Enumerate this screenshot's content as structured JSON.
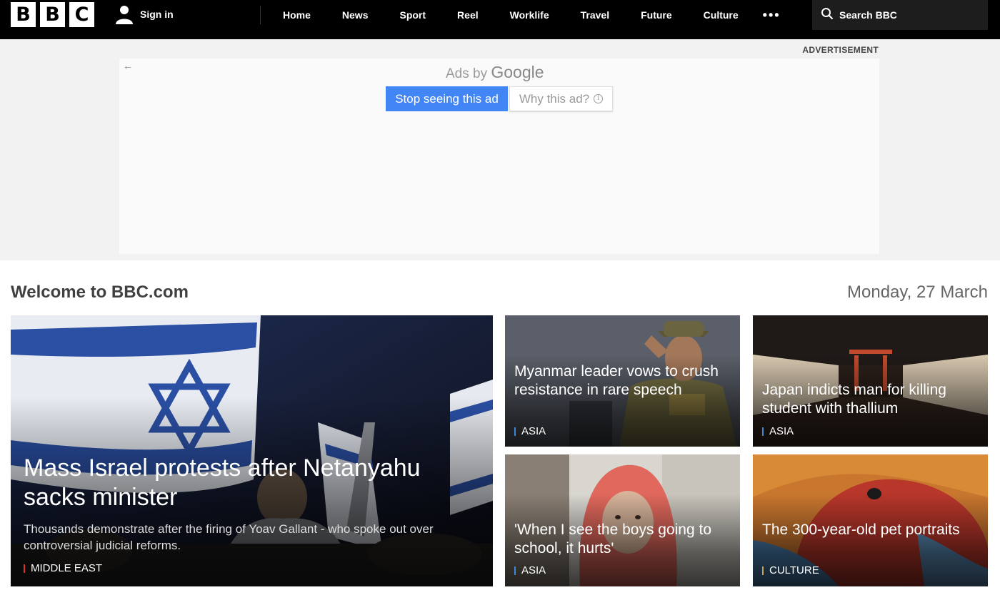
{
  "header": {
    "logo_letters": [
      "B",
      "B",
      "C"
    ],
    "sign_in": "Sign in",
    "nav": [
      "Home",
      "News",
      "Sport",
      "Reel",
      "Worklife",
      "Travel",
      "Future",
      "Culture"
    ],
    "more": "•••",
    "search_placeholder": "Search BBC"
  },
  "ad": {
    "label": "ADVERTISEMENT",
    "back_arrow": "←",
    "ads_by_prefix": "Ads by",
    "ads_by_brand": "Google",
    "stop_button": "Stop seeing this ad",
    "why_button": "Why this ad?",
    "why_icon": "i"
  },
  "welcome": {
    "title": "Welcome to BBC.com",
    "date": "Monday, 27 March"
  },
  "stories": {
    "main": {
      "headline": "Mass Israel protests after Netanyahu sacks minister",
      "summary": "Thousands demonstrate after the firing of Yoav Gallant - who spoke out over controversial judicial reforms.",
      "tag": "MIDDLE EAST",
      "tag_color": "#e0342b"
    },
    "items": [
      {
        "headline": "Myanmar leader vows to crush resistance in rare speech",
        "tag": "ASIA",
        "tag_color": "#3c87d6"
      },
      {
        "headline": "Japan indicts man for killing student with thallium",
        "tag": "ASIA",
        "tag_color": "#3c87d6"
      },
      {
        "headline": "'When I see the boys going to school, it hurts'",
        "tag": "ASIA",
        "tag_color": "#3c87d6"
      },
      {
        "headline": "The 300-year-old pet portraits",
        "tag": "CULTURE",
        "tag_color": "#c9a25a"
      }
    ]
  }
}
